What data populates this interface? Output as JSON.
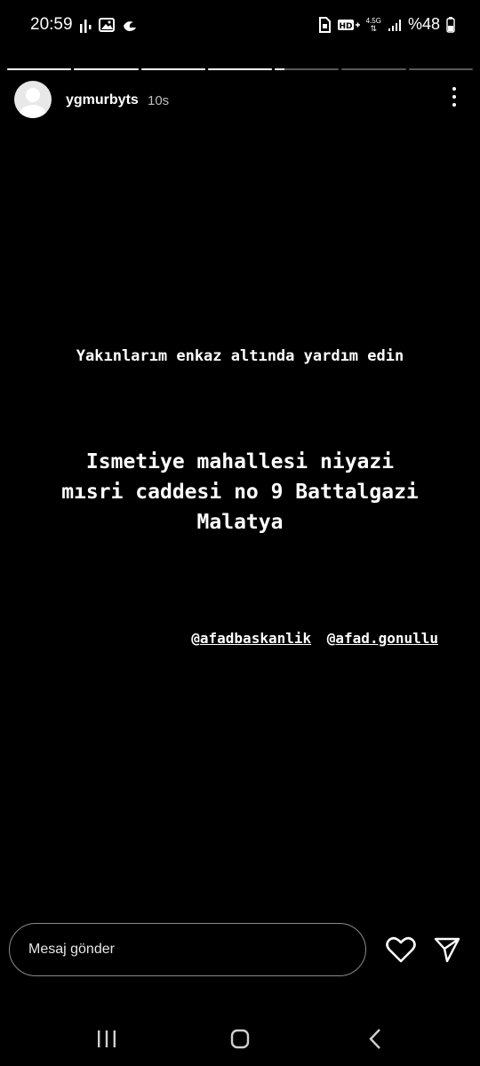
{
  "status_bar": {
    "time": "20:59",
    "battery": "%48",
    "network": "4.5G",
    "left_icons": [
      "signal-bars-icon",
      "gallery-icon",
      "moon-icon"
    ],
    "right_icons": [
      "sim-icon",
      "hd-volte-icon",
      "network-4-5g-icon",
      "signal-strength-icon",
      "battery-icon"
    ]
  },
  "story": {
    "segments": [
      1,
      1,
      1,
      1,
      0.15,
      0,
      0
    ],
    "username": "ygmurbyts",
    "time_ago": "10s",
    "line1": "Yakınlarım enkaz altında yardım edin",
    "line2": [
      "Ismetiye mahallesi niyazi",
      "mısri caddesi no 9 Battalgazi",
      "Malatya"
    ],
    "mentions": [
      "afadbaskanlik",
      "afad.gonullu"
    ]
  },
  "composer": {
    "placeholder": "Mesaj gönder",
    "icons": [
      "heart-icon",
      "send-icon"
    ]
  },
  "nav": {
    "icons": [
      "recents-icon",
      "home-icon",
      "back-icon"
    ]
  }
}
